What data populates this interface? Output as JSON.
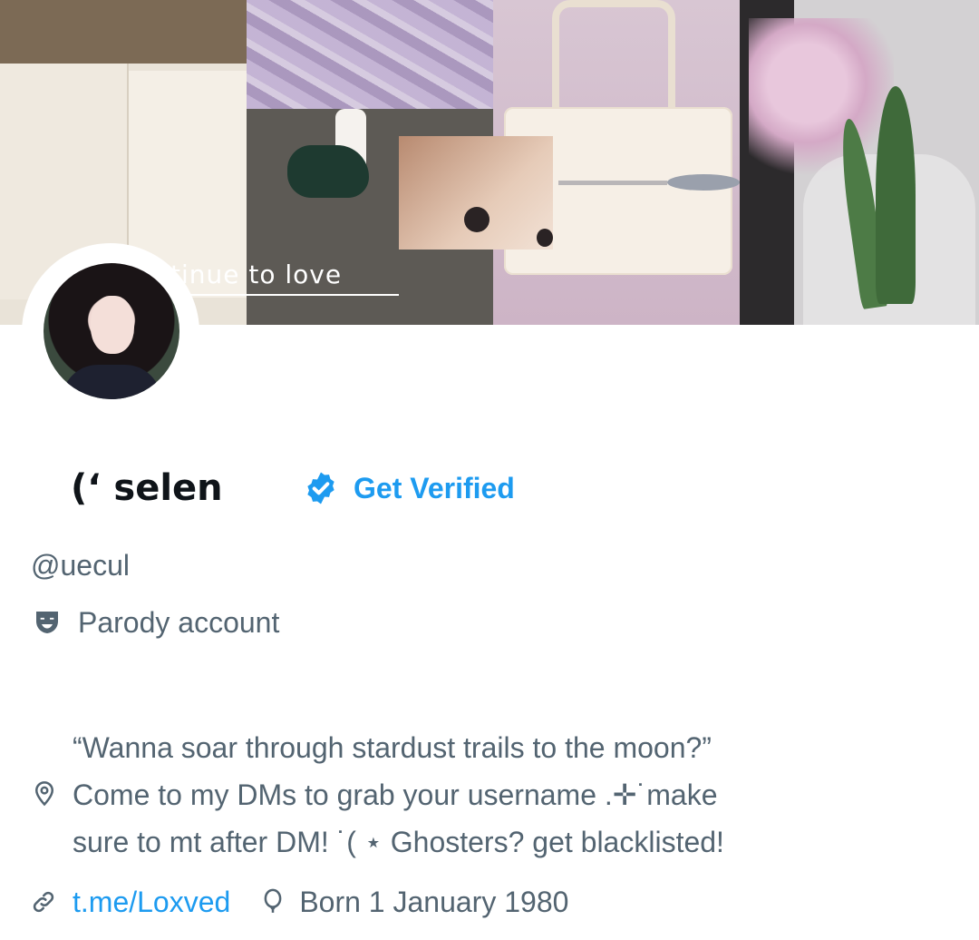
{
  "banner": {
    "caption": "tinue to love"
  },
  "profile": {
    "display_name": "(ʻ selen",
    "verify_label": "Get Verified",
    "handle": "@uecul",
    "parody_label": "Parody account",
    "bio_lines": [
      "“Wanna soar through stardust trails to the moon?”",
      "Come to my DMs to grab your username .✛˙make",
      "sure to mt after DM! ˙( ⋆ Ghosters? get blacklisted!"
    ],
    "link": "t.me/Loxved",
    "born": "Born 1 January 1980"
  },
  "colors": {
    "accent": "#1d9bf0",
    "secondary_text": "#536471",
    "primary_text": "#0f1419"
  },
  "icons": {
    "verify": "verified-badge-icon",
    "parody": "theater-mask-icon",
    "location": "location-pin-icon",
    "link": "link-icon",
    "born": "balloon-icon"
  }
}
